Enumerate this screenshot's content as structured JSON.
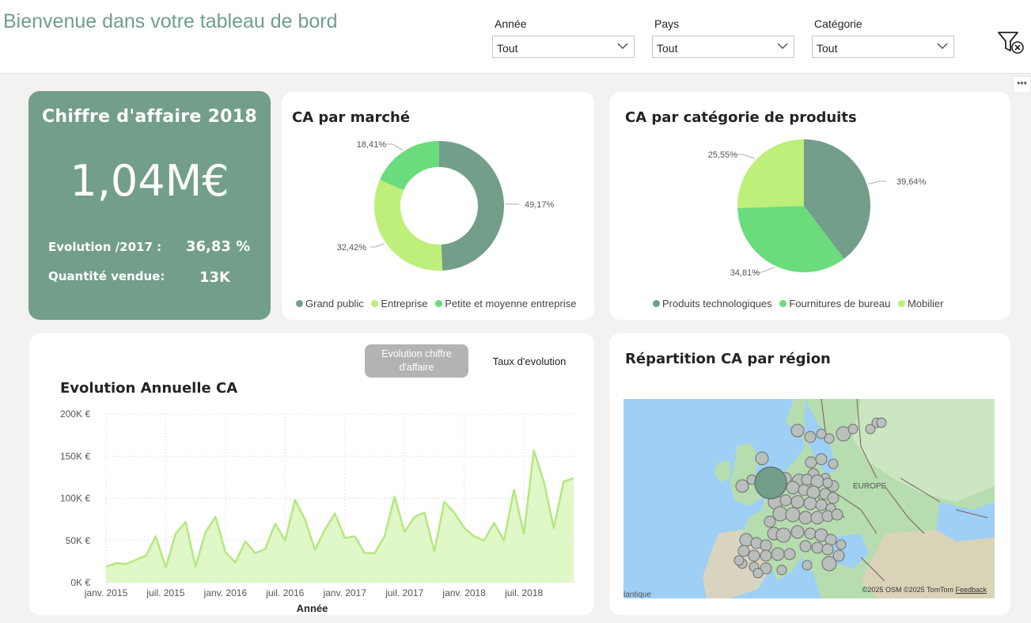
{
  "header": {
    "title": "Bienvenue dans votre tableau de bord",
    "slicers": [
      {
        "label": "Année",
        "value": "Tout"
      },
      {
        "label": "Pays",
        "value": "Tout"
      },
      {
        "label": "Catégorie",
        "value": "Tout"
      }
    ],
    "clear_filter_icon": "filter-clear-icon",
    "more_options": "•••"
  },
  "kpi": {
    "title": "Chiffre d'affaire 2018",
    "value": "1,04M€",
    "evolution_label": "Evolution /2017 :",
    "evolution_value": "36,83 %",
    "quantity_label": "Quantité vendue:",
    "quantity_value": "13K"
  },
  "colors": {
    "accent": "#739e8a",
    "green": "#6bdc7c",
    "lightgreen": "#bdef7a",
    "area": "#e0f7c8",
    "line": "#b4e880"
  },
  "market_chart": {
    "title": "CA par marché",
    "legend": [
      "Grand public",
      "Entreprise",
      "Petite et moyenne entreprise"
    ],
    "labels": [
      "49,17%",
      "32,42%",
      "18,41%"
    ]
  },
  "category_chart": {
    "title": "CA par catégorie de produits",
    "legend": [
      "Produits technologiques",
      "Fournitures de bureau",
      "Mobilier"
    ],
    "labels": [
      "39,64%",
      "34,81%",
      "25,55%"
    ]
  },
  "evolution_chart": {
    "title": "Evolution Annuelle CA",
    "toggle_active": "Evolution chiffre d'affaire",
    "toggle_inactive": "Taux d'evolution",
    "xlabel": "Année",
    "y_ticks": [
      "0K €",
      "50K €",
      "100K €",
      "150K €",
      "200K €"
    ],
    "x_ticks": [
      "janv. 2015",
      "juil. 2015",
      "janv. 2016",
      "juil. 2016",
      "janv. 2017",
      "juil. 2017",
      "janv. 2018",
      "juil. 2018"
    ]
  },
  "map_card": {
    "title": "Répartition CA par région",
    "region_label": "EUROPE",
    "ocean_label": "lantique",
    "credit": "©2025 OSM  ©2025 TomTom",
    "feedback": "Feedback"
  },
  "chart_data": [
    {
      "type": "pie",
      "title": "CA par marché",
      "categories": [
        "Grand public",
        "Entreprise",
        "Petite et moyenne entreprise"
      ],
      "values": [
        49.17,
        32.42,
        18.41
      ],
      "donut": true
    },
    {
      "type": "pie",
      "title": "CA par catégorie de produits",
      "categories": [
        "Produits technologiques",
        "Fournitures de bureau",
        "Mobilier"
      ],
      "values": [
        39.64,
        34.81,
        25.55
      ]
    },
    {
      "type": "area",
      "title": "Evolution Annuelle CA",
      "xlabel": "Année",
      "ylabel": "",
      "ylim": [
        0,
        200000
      ],
      "x": [
        "2015-01",
        "2015-02",
        "2015-03",
        "2015-04",
        "2015-05",
        "2015-06",
        "2015-07",
        "2015-08",
        "2015-09",
        "2015-10",
        "2015-11",
        "2015-12",
        "2016-01",
        "2016-02",
        "2016-03",
        "2016-04",
        "2016-05",
        "2016-06",
        "2016-07",
        "2016-08",
        "2016-09",
        "2016-10",
        "2016-11",
        "2016-12",
        "2017-01",
        "2017-02",
        "2017-03",
        "2017-04",
        "2017-05",
        "2017-06",
        "2017-07",
        "2017-08",
        "2017-09",
        "2017-10",
        "2017-11",
        "2017-12",
        "2018-01",
        "2018-02",
        "2018-03",
        "2018-04",
        "2018-05",
        "2018-06",
        "2018-07",
        "2018-08",
        "2018-09",
        "2018-10",
        "2018-11",
        "2018-12"
      ],
      "values": [
        19000,
        23000,
        22000,
        27000,
        32000,
        55000,
        18000,
        58000,
        72000,
        19000,
        60000,
        78000,
        36000,
        24000,
        49000,
        35000,
        40000,
        70000,
        50000,
        98000,
        75000,
        39000,
        63000,
        82000,
        53000,
        55000,
        35000,
        35000,
        55000,
        102000,
        60000,
        78000,
        83000,
        37000,
        96000,
        83000,
        65000,
        55000,
        50000,
        71000,
        50000,
        110000,
        58000,
        157000,
        120000,
        65000,
        120000,
        124000
      ]
    }
  ],
  "map_bubbles": [
    {
      "lon": -3.5,
      "lat": 55.5,
      "r": 22,
      "dark": true
    }
  ]
}
